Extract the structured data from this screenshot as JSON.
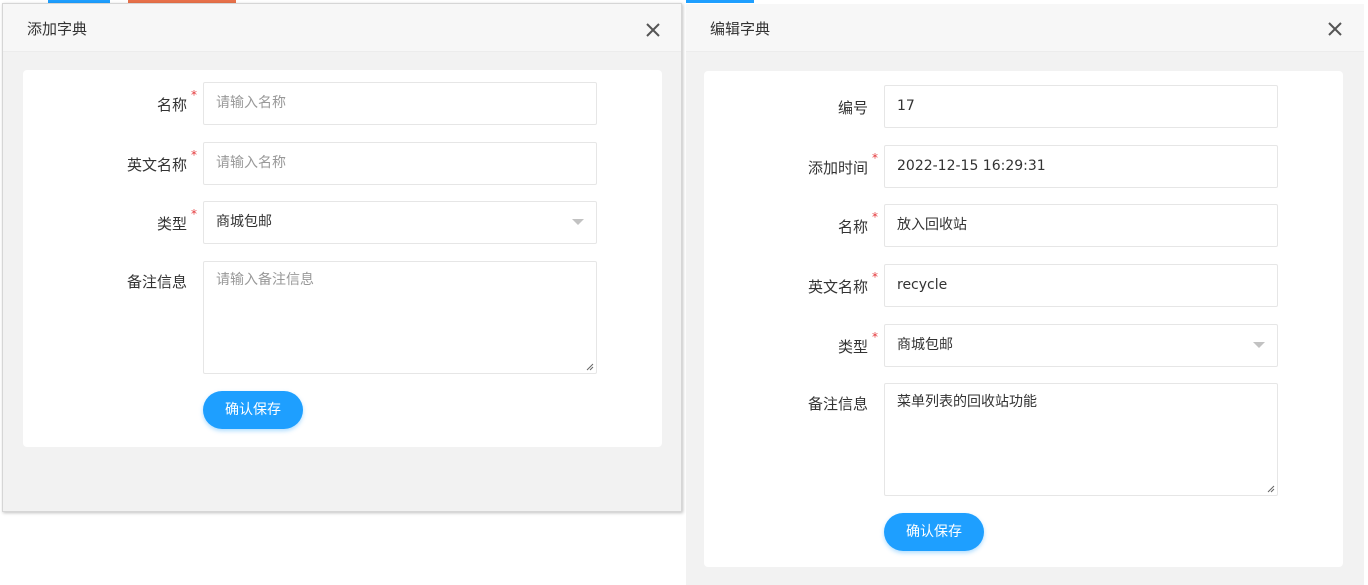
{
  "add_dialog": {
    "title": "添加字典",
    "fields": {
      "name": {
        "label": "名称",
        "placeholder": "请输入名称",
        "required": true
      },
      "en_name": {
        "label": "英文名称",
        "placeholder": "请输入名称",
        "required": true
      },
      "type": {
        "label": "类型",
        "value": "商城包邮",
        "required": true
      },
      "remark": {
        "label": "备注信息",
        "placeholder": "请输入备注信息"
      }
    },
    "save_label": "确认保存"
  },
  "edit_dialog": {
    "title": "编辑字典",
    "fields": {
      "id": {
        "label": "编号",
        "value": "17"
      },
      "added_time": {
        "label": "添加时间",
        "value": "2022-12-15 16:29:31",
        "required": true
      },
      "name": {
        "label": "名称",
        "value": "放入回收站",
        "required": true
      },
      "en_name": {
        "label": "英文名称",
        "value": "recycle",
        "required": true
      },
      "type": {
        "label": "类型",
        "value": "商城包邮",
        "required": true
      },
      "remark": {
        "label": "备注信息",
        "value": "菜单列表的回收站功能"
      }
    },
    "save_label": "确认保存"
  },
  "required_mark": "*",
  "icons": {
    "close": "close-icon",
    "select_arrow": "chevron-down-icon",
    "resize": "resize-grip-icon"
  },
  "colors": {
    "primary": "#1e9fff",
    "required": "#e4393c",
    "backdrop": "#f2f2f2"
  }
}
